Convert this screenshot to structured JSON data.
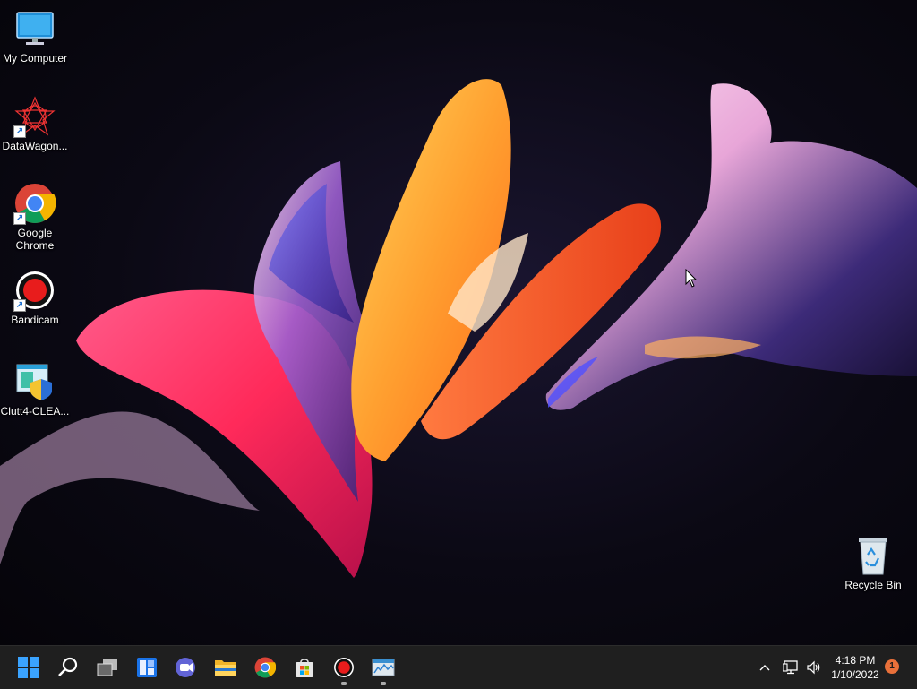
{
  "desktop": {
    "icons": [
      {
        "label": "My Computer",
        "icon": "monitor-icon"
      },
      {
        "label": "DataWagon...",
        "icon": "datawagon-icon"
      },
      {
        "label": "Google\nChrome",
        "icon": "chrome-icon"
      },
      {
        "label": "Bandicam",
        "icon": "bandicam-icon"
      },
      {
        "label": "Clutt4-CLEA...",
        "icon": "clutt-icon"
      },
      {
        "label": "Recycle Bin",
        "icon": "recycle-bin-icon"
      }
    ]
  },
  "taskbar": {
    "apps": [
      "start-icon",
      "search-icon",
      "task-view-icon",
      "widgets-icon",
      "teams-chat-icon",
      "file-explorer-icon",
      "chrome-icon",
      "store-icon",
      "bandicam-icon",
      "monitor-app-icon"
    ],
    "tray": {
      "clock_time": "4:18 PM",
      "clock_date": "1/10/2022",
      "notification_count": "1"
    }
  }
}
